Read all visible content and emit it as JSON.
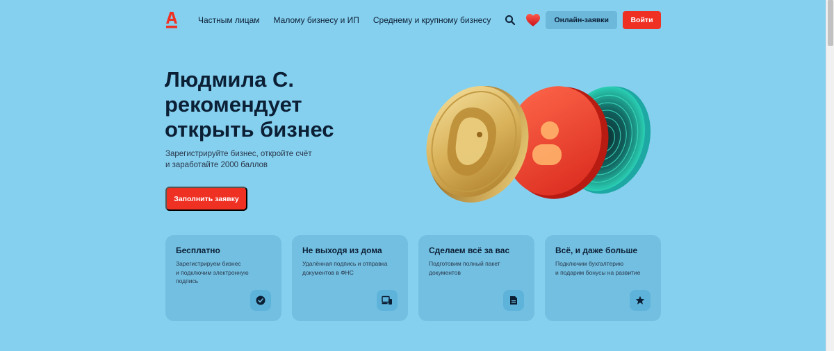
{
  "header": {
    "logo_letter": "A",
    "nav": [
      "Частным лицам",
      "Малому бизнесу и ИП",
      "Среднему и крупному бизнесу"
    ],
    "search_icon": "search-icon",
    "heart_icon": "heart-icon",
    "online_label": "Онлайн-заявки",
    "login_label": "Войти"
  },
  "hero": {
    "title_lines": [
      "Людмила С.",
      "рекомендует",
      "открыть бизнес"
    ],
    "subtitle_lines": [
      "Зарегистрируйте бизнес, откройте счёт",
      "и заработайте 2000 баллов"
    ],
    "apply_label": "Заполнить заявку"
  },
  "cards": [
    {
      "title": "Бесплатно",
      "text_lines": [
        "Зарегистрируем бизнес",
        "и подключим электронную",
        "подпись"
      ],
      "icon": "check-circle-icon"
    },
    {
      "title": "Не выходя из дома",
      "text_lines": [
        "Удалённая подпись и отправка",
        "документов в ФНС"
      ],
      "icon": "devices-icon"
    },
    {
      "title": "Сделаем всё за вас",
      "text_lines": [
        "Подготовим полный пакет",
        "документов"
      ],
      "icon": "document-icon"
    },
    {
      "title": "Всё, и даже больше",
      "text_lines": [
        "Подключим бухгалтерию",
        "и подарим бонусы на развитие"
      ],
      "icon": "star-icon"
    }
  ],
  "colors": {
    "background": "#86d0ef",
    "brand_red": "#ef3124",
    "text_dark": "#0b1f35"
  }
}
